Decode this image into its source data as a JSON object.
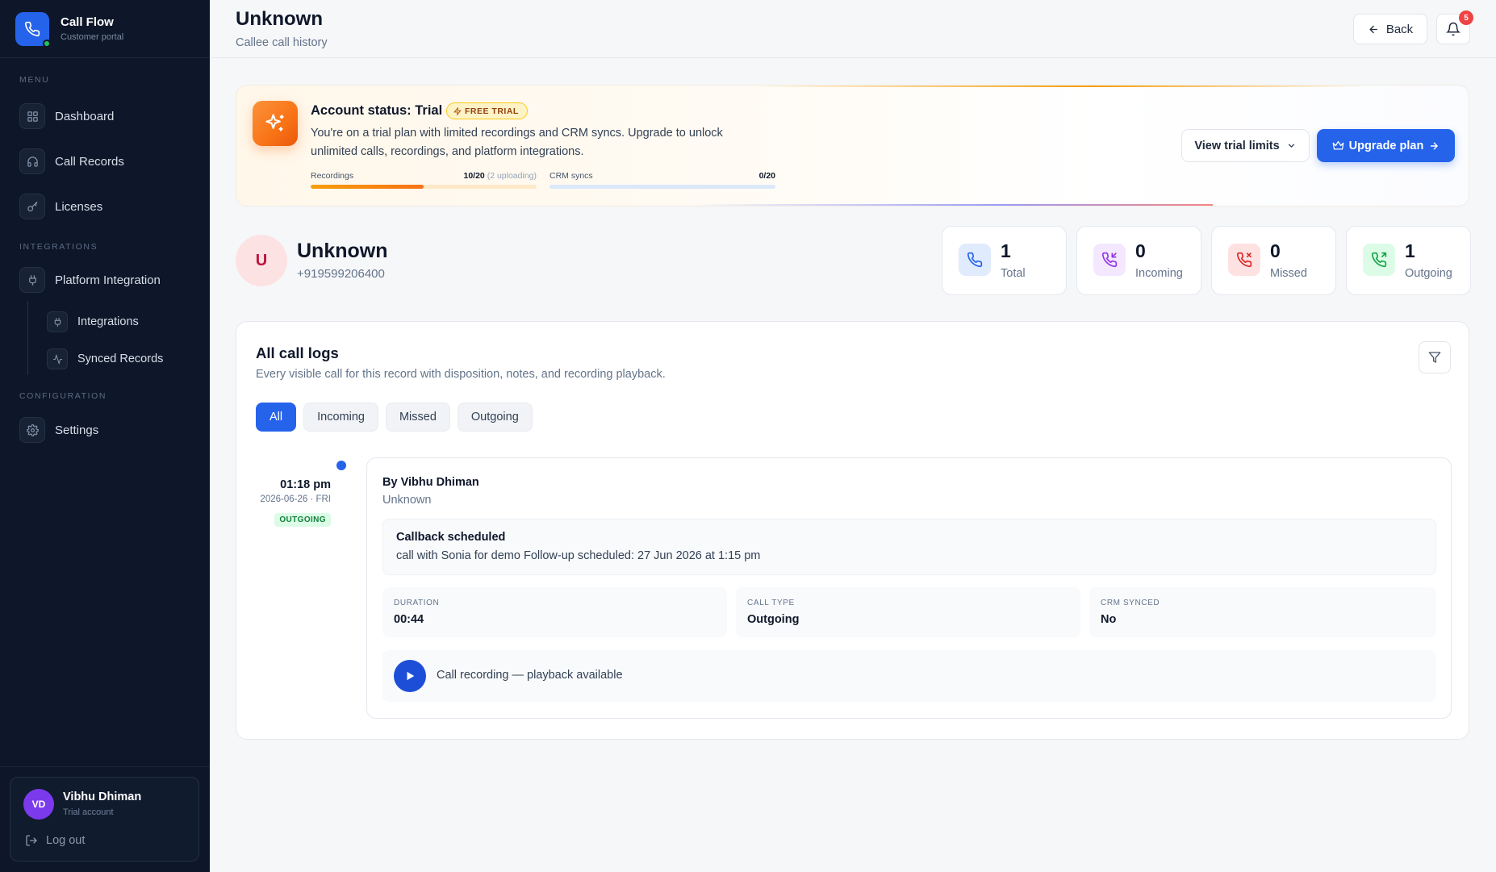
{
  "app": {
    "name": "Call Flow",
    "subtitle": "Customer portal"
  },
  "sidebar": {
    "menu_label": "MENU",
    "menu": [
      {
        "label": "Dashboard",
        "icon": "grid-icon"
      },
      {
        "label": "Call Records",
        "icon": "headphones-icon"
      },
      {
        "label": "Licenses",
        "icon": "key-icon"
      }
    ],
    "integrations_label": "INTEGRATIONS",
    "platform_integration": {
      "label": "Platform Integration",
      "icon": "plug-icon"
    },
    "sub_items": [
      {
        "label": "Integrations",
        "icon": "plug-icon"
      },
      {
        "label": "Synced Records",
        "icon": "activity-icon"
      }
    ],
    "configuration_label": "CONFIGURATION",
    "settings": {
      "label": "Settings",
      "icon": "gear-icon"
    },
    "user": {
      "initials": "VD",
      "name": "Vibhu Dhiman",
      "role": "Trial account"
    },
    "logout_label": "Log out"
  },
  "header": {
    "title": "Unknown",
    "subtitle": "Callee call history",
    "back_label": "Back",
    "notification_count": "5"
  },
  "trial": {
    "title": "Account status: Trial",
    "pill": "FREE TRIAL",
    "description": "You're on a trial plan with limited recordings and CRM syncs. Upgrade to unlock unlimited calls, recordings, and platform integrations.",
    "recordings": {
      "label": "Recordings",
      "value": "10/20",
      "note": "(2 uploading)",
      "fill_fraction": 0.5
    },
    "crm": {
      "label": "CRM syncs",
      "value": "0/20",
      "fill_fraction": 0
    },
    "view_limits_label": "View trial limits",
    "upgrade_label": "Upgrade plan"
  },
  "contact": {
    "initial": "U",
    "name": "Unknown",
    "phone": "+919599206400"
  },
  "stats": [
    {
      "value": "1",
      "label": "Total",
      "icon": "phone-icon",
      "color": "#2563eb",
      "bg": "#e0ebfd"
    },
    {
      "value": "0",
      "label": "Incoming",
      "icon": "phone-incoming-icon",
      "color": "#9333ea",
      "bg": "#f3e8ff"
    },
    {
      "value": "0",
      "label": "Missed",
      "icon": "phone-missed-icon",
      "color": "#dc2626",
      "bg": "#fee2e2"
    },
    {
      "value": "1",
      "label": "Outgoing",
      "icon": "phone-outgoing-icon",
      "color": "#16a34a",
      "bg": "#dcfce7"
    }
  ],
  "logs": {
    "title": "All call logs",
    "subtitle": "Every visible call for this record with disposition, notes, and recording playback.",
    "tabs": [
      "All",
      "Incoming",
      "Missed",
      "Outgoing"
    ],
    "active_tab": "All",
    "entries": [
      {
        "time": "01:18 pm",
        "date": "2026-06-26 · FRI",
        "tag": "OUTGOING",
        "by": "By Vibhu Dhiman",
        "contact": "Unknown",
        "note_title": "Callback scheduled",
        "note_body": "call with Sonia for demo Follow-up scheduled: 27 Jun 2026 at 1:15 pm",
        "meta": [
          {
            "label": "DURATION",
            "value": "00:44"
          },
          {
            "label": "CALL TYPE",
            "value": "Outgoing"
          },
          {
            "label": "CRM SYNCED",
            "value": "No"
          }
        ],
        "recording_label": "Call recording — playback available"
      }
    ]
  }
}
